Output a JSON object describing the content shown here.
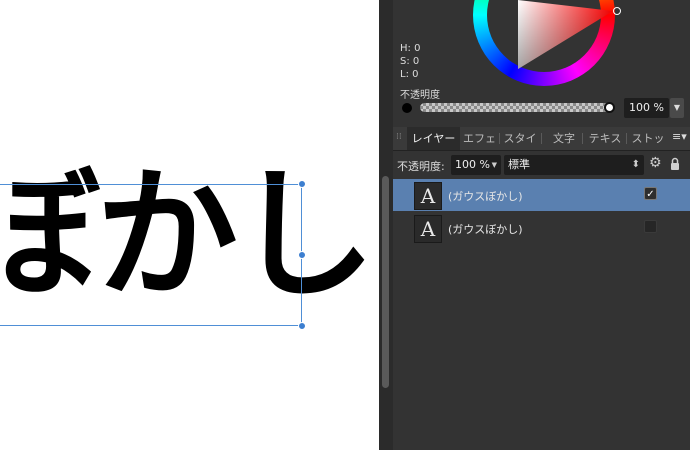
{
  "canvas": {
    "text": "ぼかし"
  },
  "color_panel": {
    "h_label": "H: 0",
    "s_label": "S: 0",
    "l_label": "L: 0",
    "opacity_label": "不透明度",
    "opacity_value": "100 %",
    "opacity_level": 1.0,
    "wheel_hue": "#ff0000"
  },
  "tabs": [
    {
      "label": "レイヤー",
      "active": true
    },
    {
      "label": "エフェ",
      "active": false
    },
    {
      "label": "スタイ",
      "active": false
    },
    {
      "label": "文字",
      "active": false
    },
    {
      "label": "テキス",
      "active": false
    },
    {
      "label": "ストッ",
      "active": false
    }
  ],
  "layers_toolbar": {
    "opacity_label": "不透明度:",
    "opacity_value": "100 %",
    "blend_mode": "標準"
  },
  "layers": [
    {
      "name": "(ガウスぼかし)",
      "thumb": "A",
      "selected": true,
      "visible": true
    },
    {
      "name": "(ガウスぼかし)",
      "thumb": "A",
      "selected": false,
      "visible": false
    }
  ],
  "colors": {
    "selection": "#4f8fd6",
    "panel_bg": "#333333",
    "selected_row": "#5a80b0"
  }
}
